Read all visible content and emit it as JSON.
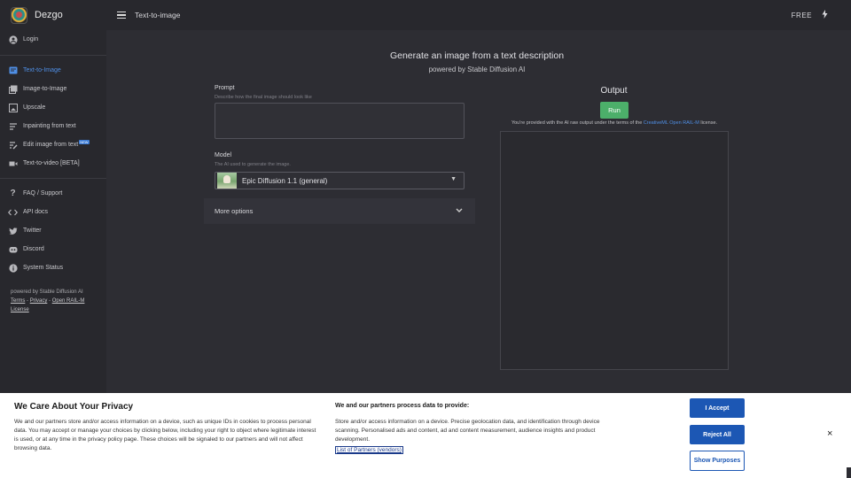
{
  "brand": {
    "name": "Dezgo"
  },
  "sidebar": {
    "login": "Login",
    "tools": [
      {
        "label": "Text-to-Image",
        "icon": "image-text-icon",
        "active": true
      },
      {
        "label": "Image-to-Image",
        "icon": "images-icon"
      },
      {
        "label": "Upscale",
        "icon": "upscale-icon"
      },
      {
        "label": "Inpainting from text",
        "icon": "inpaint-icon"
      },
      {
        "label": "Edit image from text",
        "icon": "edit-icon",
        "badge": "NEW"
      },
      {
        "label": "Text-to-video [BETA]",
        "icon": "video-icon"
      }
    ],
    "links": [
      {
        "label": "FAQ / Support",
        "icon": "question-icon"
      },
      {
        "label": "API docs",
        "icon": "code-icon"
      },
      {
        "label": "Twitter",
        "icon": "twitter-icon"
      },
      {
        "label": "Discord",
        "icon": "discord-icon"
      },
      {
        "label": "System Status",
        "icon": "info-icon"
      }
    ],
    "footer": {
      "powered": "powered by Stable Diffusion AI",
      "terms": "Terms",
      "sep1": " - ",
      "privacy": "Privacy",
      "sep2": " - ",
      "license": "Open RAIL-M License"
    }
  },
  "topbar": {
    "title": "Text-to-image",
    "plan": "FREE"
  },
  "main": {
    "headline": "Generate an image from a text description",
    "subline": "powered by Stable Diffusion AI",
    "prompt": {
      "label": "Prompt",
      "help": "Describe how the final image should look like",
      "value": ""
    },
    "model": {
      "label": "Model",
      "help": "The AI used to generate the image.",
      "selected": "Epic Diffusion 1.1 (general)"
    },
    "more_options": "More options"
  },
  "output": {
    "title": "Output",
    "run_label": "Run",
    "license_prefix": "You're provided with the AI raw output under the terms of the ",
    "license_link": "CreativeML Open RAIL-M",
    "license_suffix": " license."
  },
  "cookie": {
    "title": "We Care About Your Privacy",
    "text": "We and our partners store and/or access information on a device, such as unique IDs in cookies to process personal data. You may accept or manage your choices by clicking below, including your right to object where legitimate interest is used, or at any time in the privacy policy page. These choices will be signaled to our partners and will not affect browsing data.",
    "partners_title": "We and our partners process data to provide:",
    "partners_text": "Store and/or access information on a device. Precise geolocation data, and identification through device scanning. Personalised ads and content, ad and content measurement, audience insights and product development.",
    "partners_link": "List of Partners (vendors)",
    "accept": "I Accept",
    "reject": "Reject All",
    "purposes": "Show Purposes",
    "close": "×"
  },
  "colors": {
    "accent": "#4f8fe6",
    "run": "#4caf6a",
    "consent_blue": "#1c57b4"
  }
}
